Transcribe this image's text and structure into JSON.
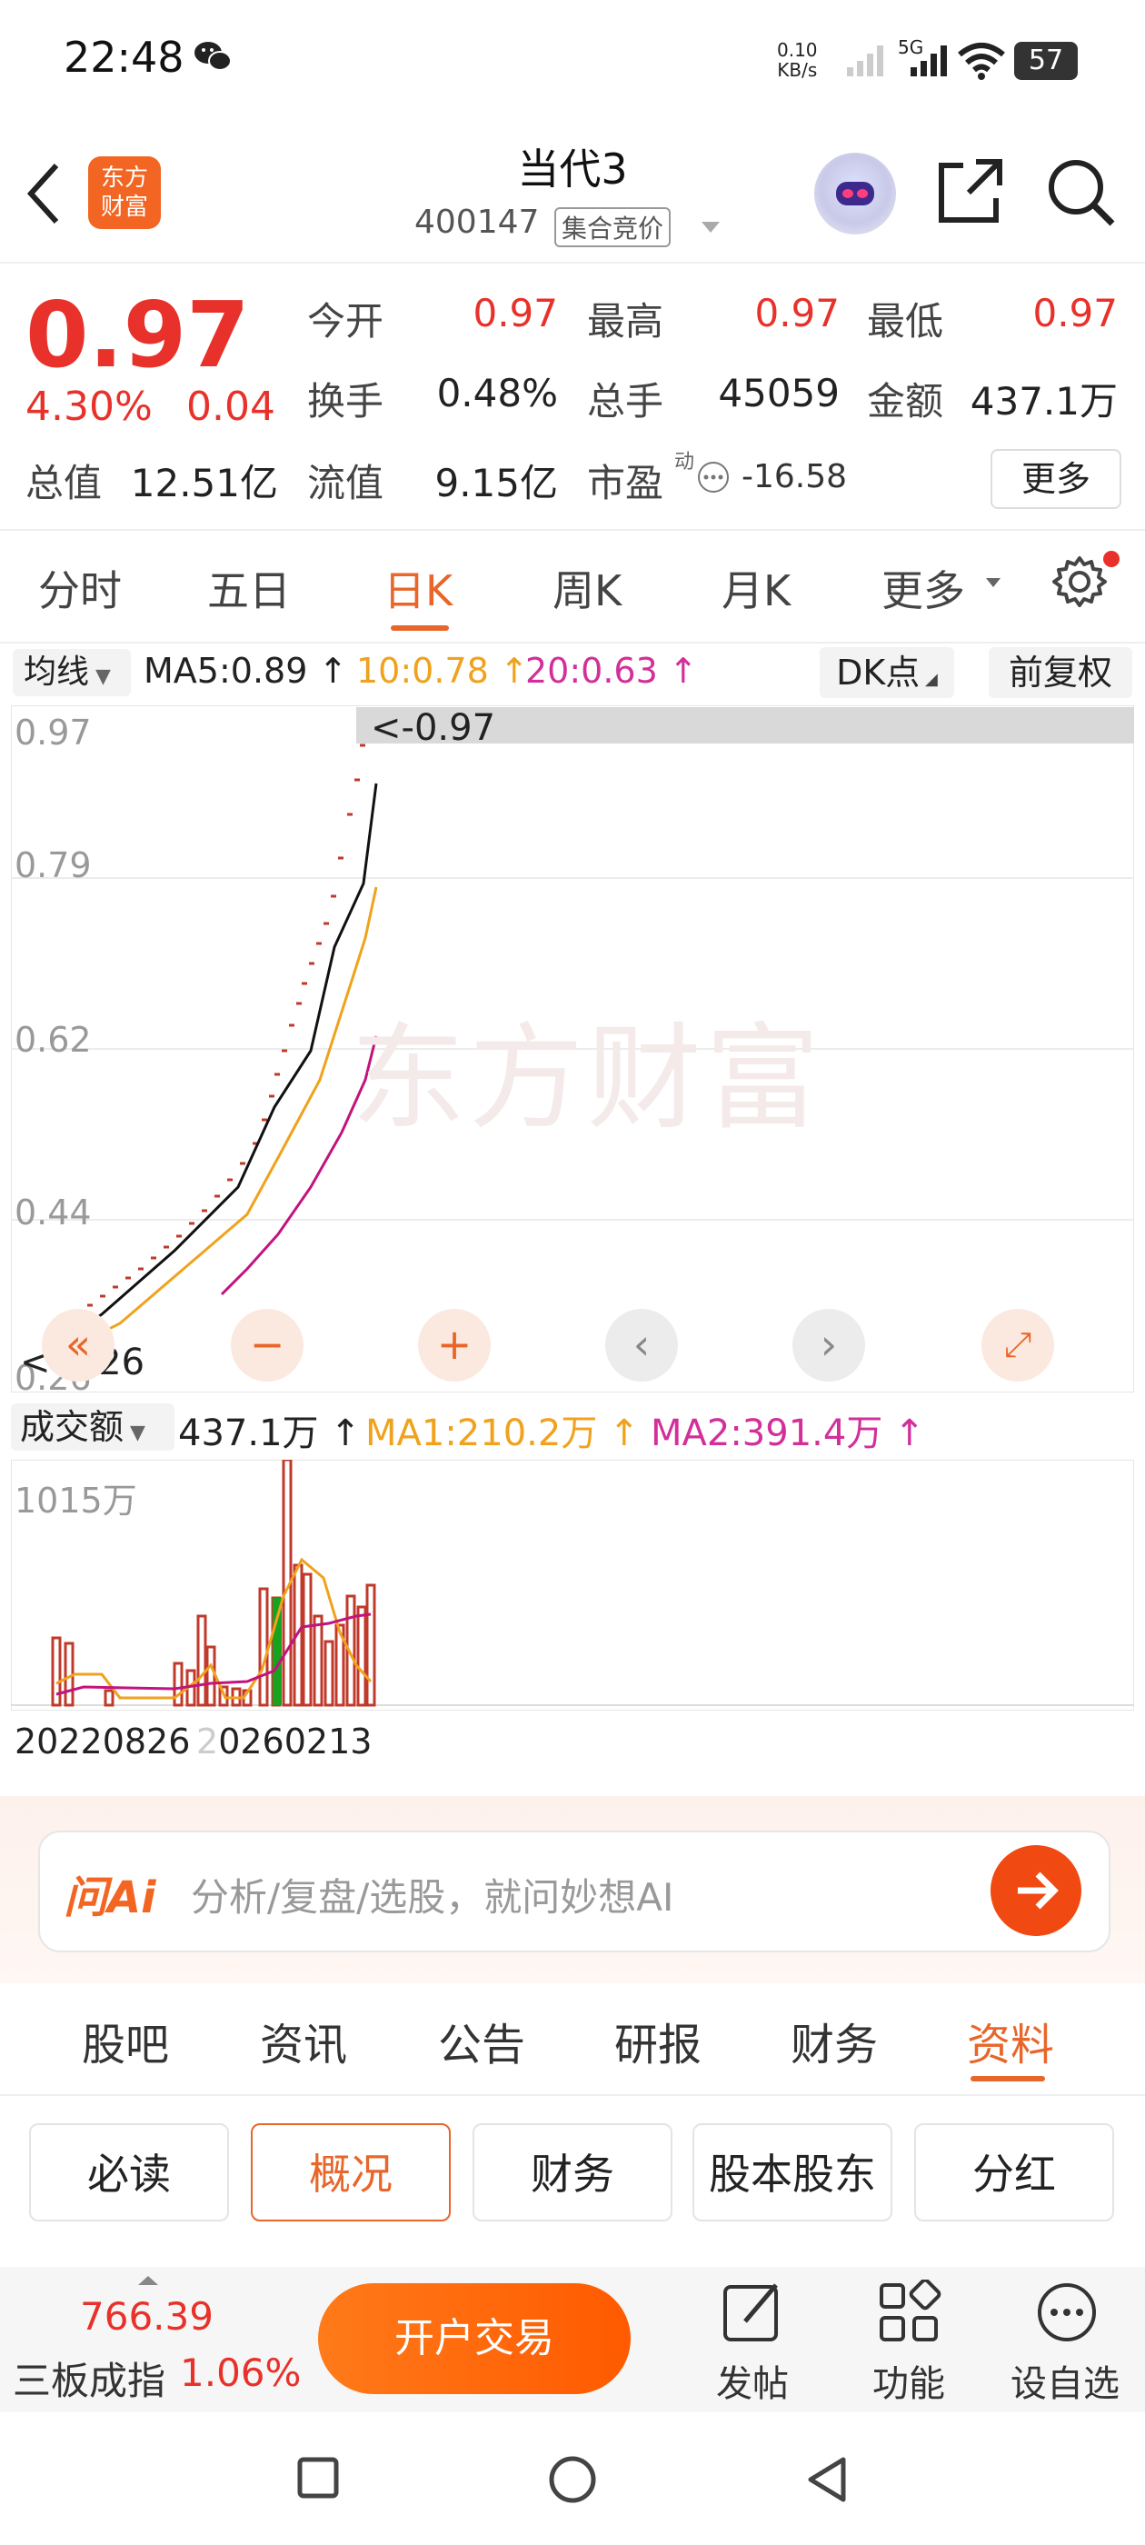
{
  "status_bar": {
    "time": "22:48",
    "net_speed_top": "0.10",
    "net_speed_bottom": "KB/s",
    "network": "5G",
    "battery": "57"
  },
  "header": {
    "logo_line1": "东方",
    "logo_line2": "财富",
    "title": "当代3",
    "code": "400147",
    "auction_badge": "集合竞价"
  },
  "quote": {
    "price": "0.97",
    "change_pct": "4.30%",
    "change": "0.04",
    "open_label": "今开",
    "open": "0.97",
    "high_label": "最高",
    "high": "0.97",
    "low_label": "最低",
    "low": "0.97",
    "turnover_label": "换手",
    "turnover": "0.48%",
    "volume_label": "总手",
    "volume": "45059",
    "amount_label": "金额",
    "amount": "437.1万",
    "mktcap_label": "总值",
    "mktcap": "12.51亿",
    "float_label": "流值",
    "float_cap": "9.15亿",
    "pe_label": "市盈",
    "pe_sup": "动",
    "pe": "-16.58",
    "more_button": "更多"
  },
  "period_tabs": [
    "分时",
    "五日",
    "日K",
    "周K",
    "月K",
    "更多"
  ],
  "active_period": "日K",
  "indicators": {
    "ma_button": "均线",
    "ma5": "MA5:0.89 ↑",
    "ma10": "10:0.78 ↑",
    "ma20": "20:0.63 ↑",
    "dk_button": "DK点",
    "adjust_button": "前复权"
  },
  "kline": {
    "price_labels": [
      "0.97",
      "0.79",
      "0.62",
      "0.44",
      "0.26"
    ],
    "current_marker": "<-0.97",
    "low_marker": "<-0.26",
    "watermark": "东方财富"
  },
  "volume": {
    "indicator_button": "成交额",
    "value": "437.1万 ↑",
    "ma1": "MA1:210.2万 ↑",
    "ma2": "MA2:391.4万 ↑",
    "max_label": "1015万",
    "date_start": "20220826",
    "date_end_prefix": "2",
    "date_end_rest": "0260213"
  },
  "ai_bar": {
    "logo": "问Ai",
    "placeholder": "分析/复盘/选股，就问妙想AI"
  },
  "info_tabs": [
    "股吧",
    "资讯",
    "公告",
    "研报",
    "财务",
    "资料"
  ],
  "active_info_tab": "资料",
  "sub_buttons": [
    "必读",
    "概况",
    "财务",
    "股本股东",
    "分红"
  ],
  "active_sub_button": "概况",
  "bottom_bar": {
    "index_value": "766.39",
    "index_name": "三板成指",
    "index_pct": "1.06%",
    "trade_button": "开户交易",
    "post_label": "发帖",
    "function_label": "功能",
    "watchlist_label": "设自选"
  },
  "colors": {
    "up_red": "#e8312a",
    "accent_orange": "#e8662a",
    "ma10_orange": "#f0a21d",
    "ma20_magenta": "#d22f9a",
    "down_green": "#19a21d"
  }
}
